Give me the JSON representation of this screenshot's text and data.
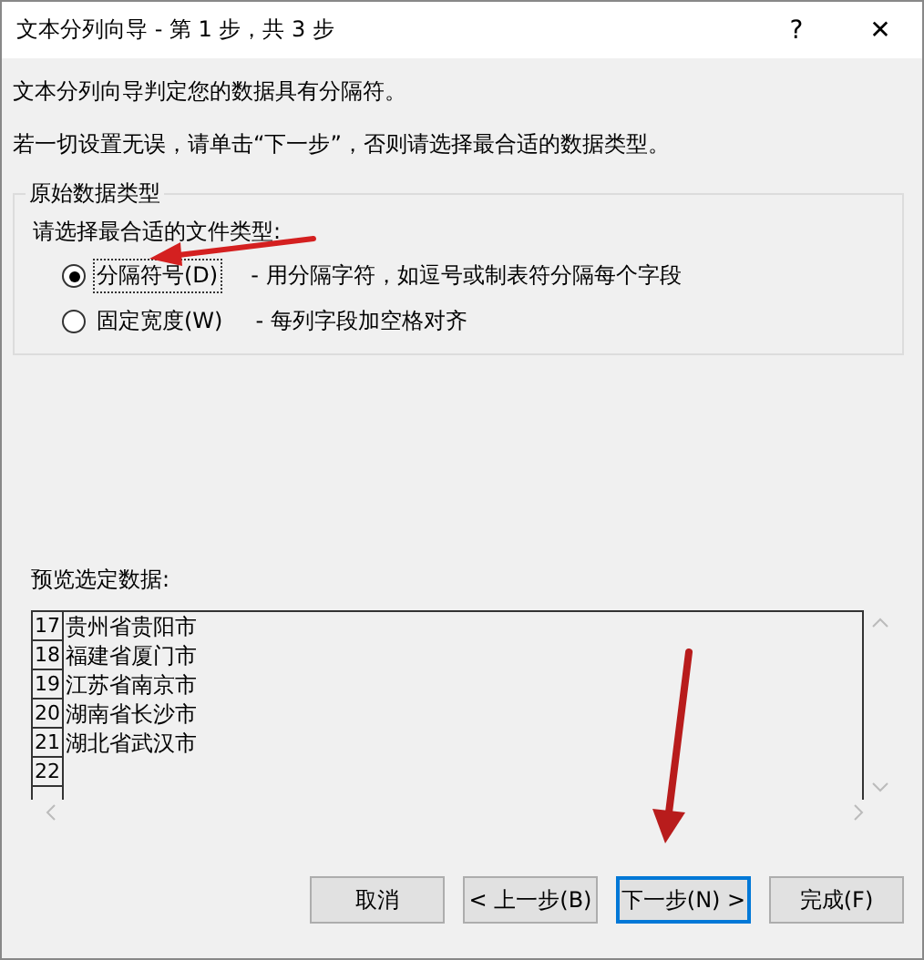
{
  "window": {
    "title": "文本分列向导 - 第 1 步，共 3 步",
    "help": "?",
    "close": "✕"
  },
  "intro": [
    "文本分列向导判定您的数据具有分隔符。",
    "若一切设置无误，请单击“下一步”，否则请选择最合适的数据类型。"
  ],
  "group": {
    "title": "原始数据类型",
    "prompt": "请选择最合适的文件类型:",
    "options": [
      {
        "label": "分隔符号(D)",
        "description": "- 用分隔字符，如逗号或制表符分隔每个字段",
        "selected": true
      },
      {
        "label": "固定宽度(W)",
        "description": "- 每列字段加空格对齐",
        "selected": false
      }
    ]
  },
  "preview": {
    "label": "预览选定数据:",
    "rows": [
      {
        "number": "17",
        "text": "贵州省贵阳市"
      },
      {
        "number": "18",
        "text": "福建省厦门市"
      },
      {
        "number": "19",
        "text": "江苏省南京市"
      },
      {
        "number": "20",
        "text": "湖南省长沙市"
      },
      {
        "number": "21",
        "text": "湖北省武汉市"
      },
      {
        "number": "22",
        "text": ""
      }
    ]
  },
  "buttons": [
    {
      "label": "取消",
      "focused": false
    },
    {
      "label": "< 上一步(B)",
      "focused": false
    },
    {
      "label": "下一步(N) >",
      "focused": true
    },
    {
      "label": "完成(F)",
      "focused": false
    }
  ]
}
